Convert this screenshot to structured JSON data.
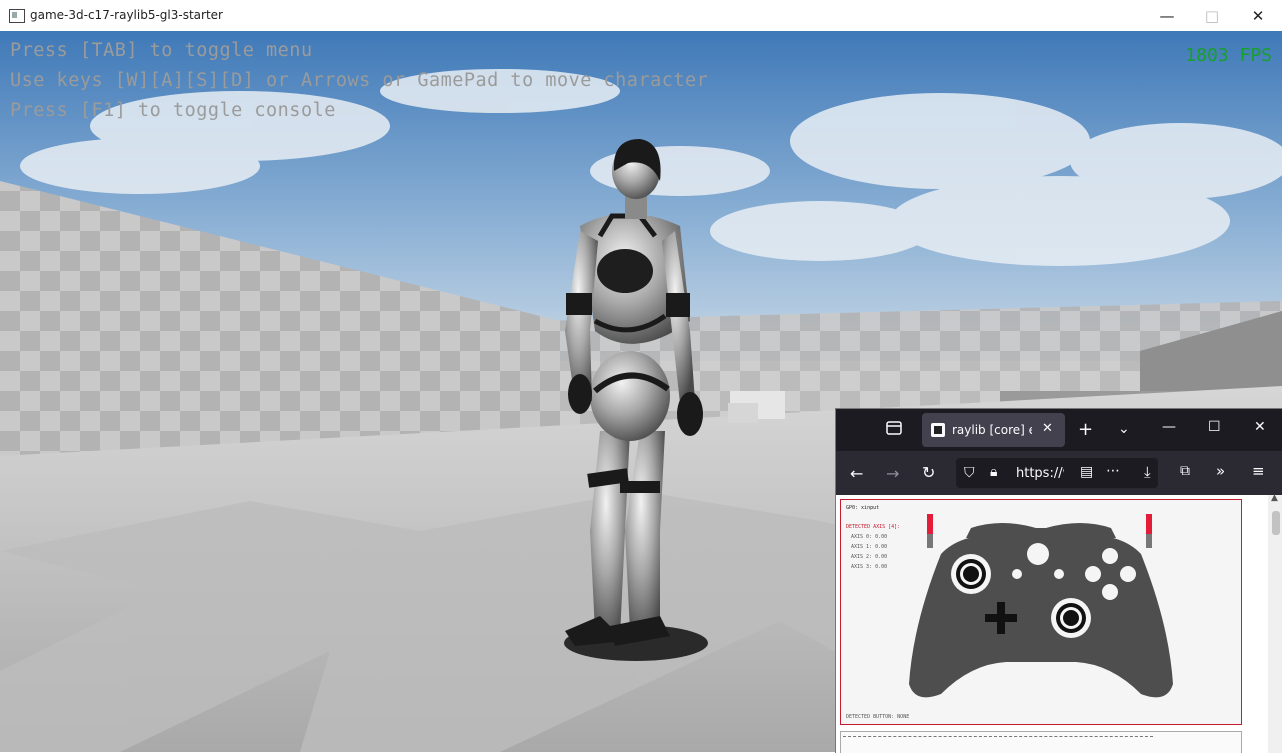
{
  "window": {
    "title": "game-3d-c17-raylib5-gl3-starter",
    "minimize_icon": "—",
    "maximize_icon": "□",
    "close_icon": "✕"
  },
  "hud": {
    "line1": "Press [TAB] to toggle menu",
    "line2": "Use keys [W][A][S][D] or Arrows or GamePad to move character",
    "line3": "Press [F1] to toggle console",
    "fps": "1803 FPS"
  },
  "browser": {
    "tab_title": "raylib [core] exar",
    "url": "https://w",
    "gamepad": {
      "gp_name": "GP0: xinput",
      "detected_axis": "DETECTED AXIS [4]:",
      "axis": [
        "AXIS 0: 0.00",
        "AXIS 1: 0.00",
        "AXIS 2: 0.00",
        "AXIS 3: 0.00"
      ],
      "detected_button": "DETECTED BUTTON: NONE"
    }
  },
  "colors": {
    "fps": "#16a02c",
    "hud_text": "#9b9b9b",
    "canvas_border": "#c61a30"
  }
}
